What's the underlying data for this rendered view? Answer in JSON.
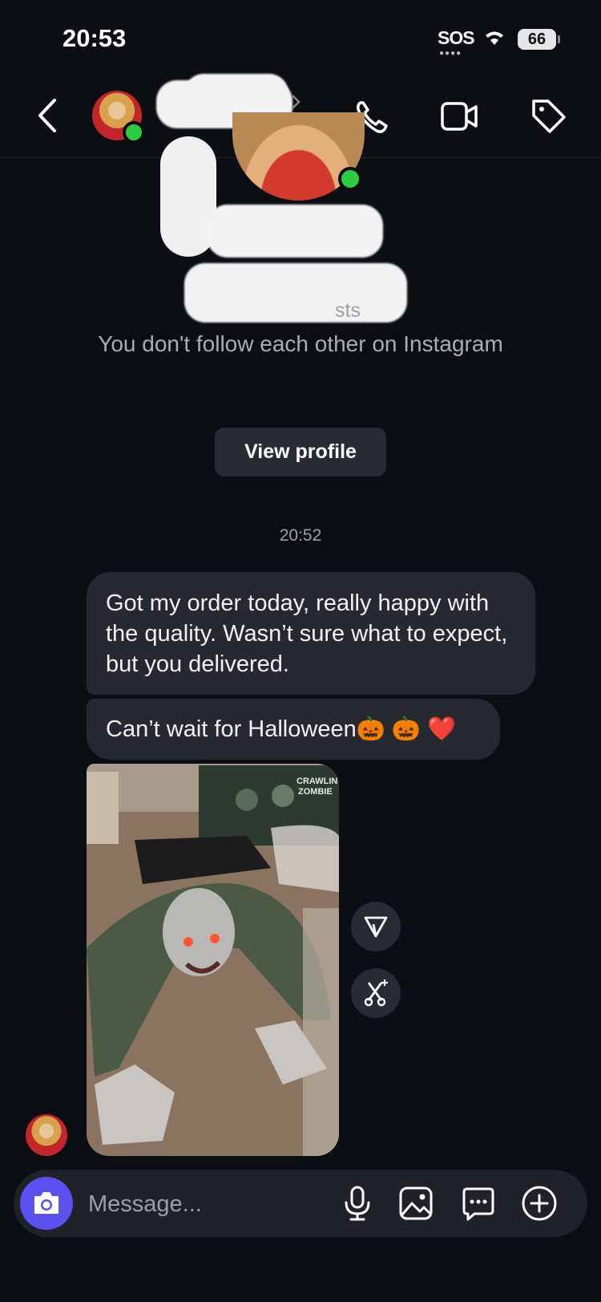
{
  "status_bar": {
    "time": "20:53",
    "sos": "SOS",
    "sos_dots": "●●●●",
    "battery": "66"
  },
  "header": {
    "back_icon": "chevron-left-icon",
    "call_icon": "phone-icon",
    "video_icon": "video-camera-icon",
    "tag_icon": "tag-icon"
  },
  "profile": {
    "posts_fragment": "sts",
    "follow_status": "You don't follow each other on Instagram",
    "view_profile_label": "View profile"
  },
  "thread": {
    "timestamp": "20:52",
    "messages": [
      {
        "text": "Got my order today, really happy with the quality. Wasn’t sure what to expect, but you delivered."
      },
      {
        "text": "Can’t wait for Halloween🎃 🎃 ❤️"
      }
    ],
    "photo": {
      "box_text_line1": "CRAWLIN",
      "box_text_line2": "ZOMBIE"
    },
    "photo_actions": [
      "share-icon",
      "ai-edit-icon"
    ]
  },
  "composer": {
    "placeholder": "Message...",
    "icons": [
      "camera-icon",
      "microphone-icon",
      "gallery-icon",
      "sticker-icon",
      "plus-icon"
    ]
  },
  "colors": {
    "background": "#0b0f14",
    "bubble": "#26292f",
    "camera_button": "#5b51f0",
    "online": "#2ecc40"
  }
}
